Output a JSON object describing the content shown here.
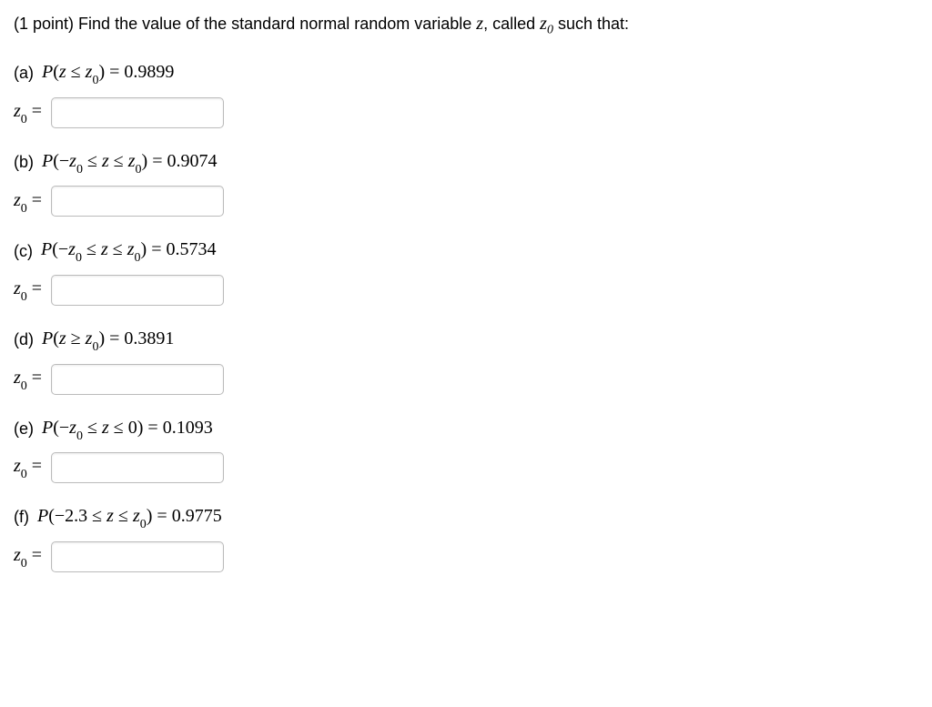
{
  "preamble": {
    "points": "(1 point)",
    "text1": " Find the value of the standard normal random variable ",
    "var_z": "z",
    "text2": ", called ",
    "z0_base": "z",
    "z0_sub": "0",
    "text3": " such that:"
  },
  "parts": [
    {
      "label": "(a)",
      "expr_prefix": "P",
      "expr_open": "(",
      "left": "z",
      "op": " ≤ ",
      "right_base": "z",
      "right_sub": "0",
      "expr_close": ")",
      "equals": " = ",
      "value": "0.9899"
    },
    {
      "label": "(b)",
      "expr_prefix": "P",
      "expr_open": "(",
      "neg": "−",
      "left_base": "z",
      "left_sub": "0",
      "op": " ≤ ",
      "mid": "z",
      "op2": " ≤ ",
      "right_base": "z",
      "right_sub": "0",
      "expr_close": ")",
      "equals": " = ",
      "value": "0.9074"
    },
    {
      "label": "(c)",
      "expr_prefix": "P",
      "expr_open": "(",
      "neg": "−",
      "left_base": "z",
      "left_sub": "0",
      "op": " ≤ ",
      "mid": "z",
      "op2": " ≤ ",
      "right_base": "z",
      "right_sub": "0",
      "expr_close": ")",
      "equals": " = ",
      "value": "0.5734"
    },
    {
      "label": "(d)",
      "expr_prefix": "P",
      "expr_open": "(",
      "left": "z",
      "op": " ≥ ",
      "right_base": "z",
      "right_sub": "0",
      "expr_close": ")",
      "equals": " = ",
      "value": "0.3891"
    },
    {
      "label": "(e)",
      "expr_prefix": "P",
      "expr_open": "(",
      "neg": "−",
      "left_base": "z",
      "left_sub": "0",
      "op": " ≤ ",
      "mid": "z",
      "op2": " ≤ ",
      "right_plain": "0",
      "expr_close": ")",
      "equals": " = ",
      "value": "0.1093"
    },
    {
      "label": "(f)",
      "expr_prefix": "P",
      "expr_open": "(",
      "neg": "−",
      "left_plain": "2.3",
      "op": " ≤ ",
      "mid": "z",
      "op2": " ≤ ",
      "right_base": "z",
      "right_sub": "0",
      "expr_close": ")",
      "equals": " = ",
      "value": "0.9775"
    }
  ],
  "answer": {
    "label_base": "z",
    "label_sub": "0",
    "label_eq": " ="
  }
}
